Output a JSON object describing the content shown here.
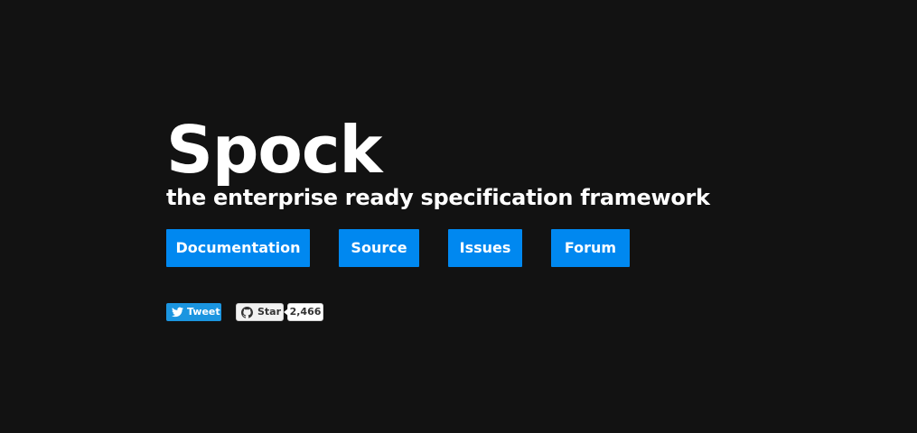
{
  "hero": {
    "title": "Spock",
    "tagline": "the enterprise ready specification framework"
  },
  "buttons": {
    "documentation": "Documentation",
    "source": "Source",
    "issues": "Issues",
    "forum": "Forum"
  },
  "social": {
    "tweet_label": "Tweet",
    "star_label": "Star",
    "star_count": "2,466"
  },
  "icons": {
    "twitter": "twitter-bird-icon",
    "github": "github-octocat-icon"
  },
  "colors": {
    "background": "#121212",
    "button": "#0088f0",
    "tweet": "#1b95e0",
    "text": "#ffffff"
  }
}
